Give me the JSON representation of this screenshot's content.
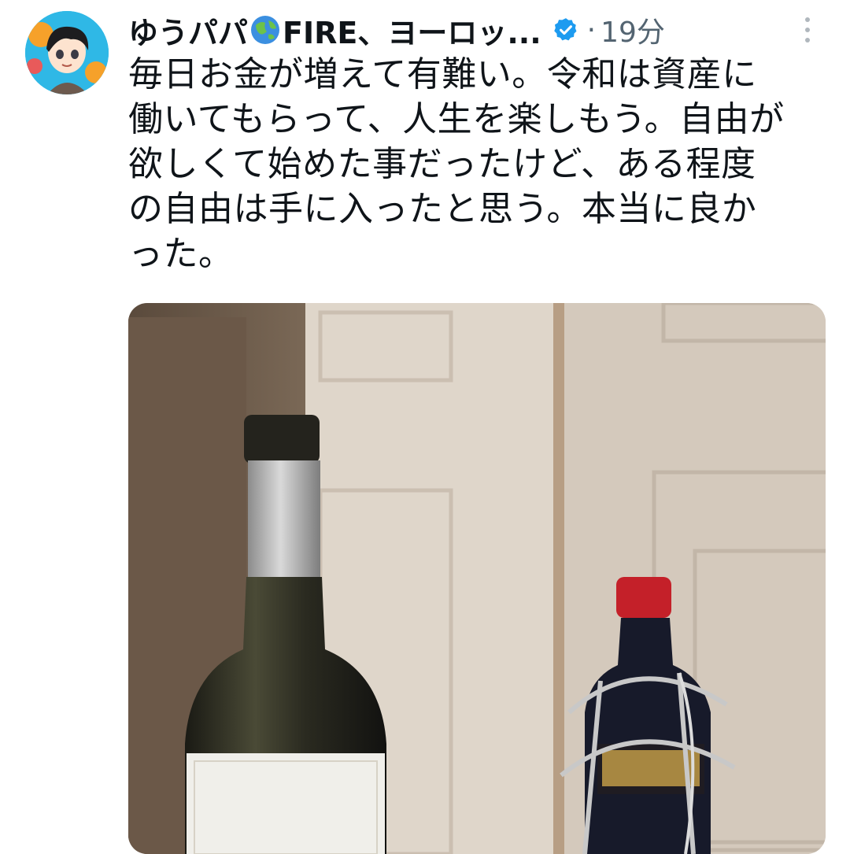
{
  "tweet": {
    "author": {
      "display_name_prefix": "ゆうパパ",
      "display_name_suffix": "FIRE、ヨーロッ...",
      "flag_emoji_name": "globe-emoji",
      "verified": true
    },
    "separator": "·",
    "timestamp": "19分",
    "text_lines": [
      "毎日お金が増えて有難い。令和は資産に",
      "働いてもらって、人生を楽しもう。自由が",
      "欲しくて始めた事だったけど、ある程度",
      "の自由は手に入ったと思う。本当に良か",
      "った。"
    ],
    "media": {
      "type": "photo"
    }
  },
  "colors": {
    "text": "#0f1419",
    "secondary": "#536471",
    "verified": "#1d9bf0",
    "avatar_bg": "#2fb8e6"
  }
}
